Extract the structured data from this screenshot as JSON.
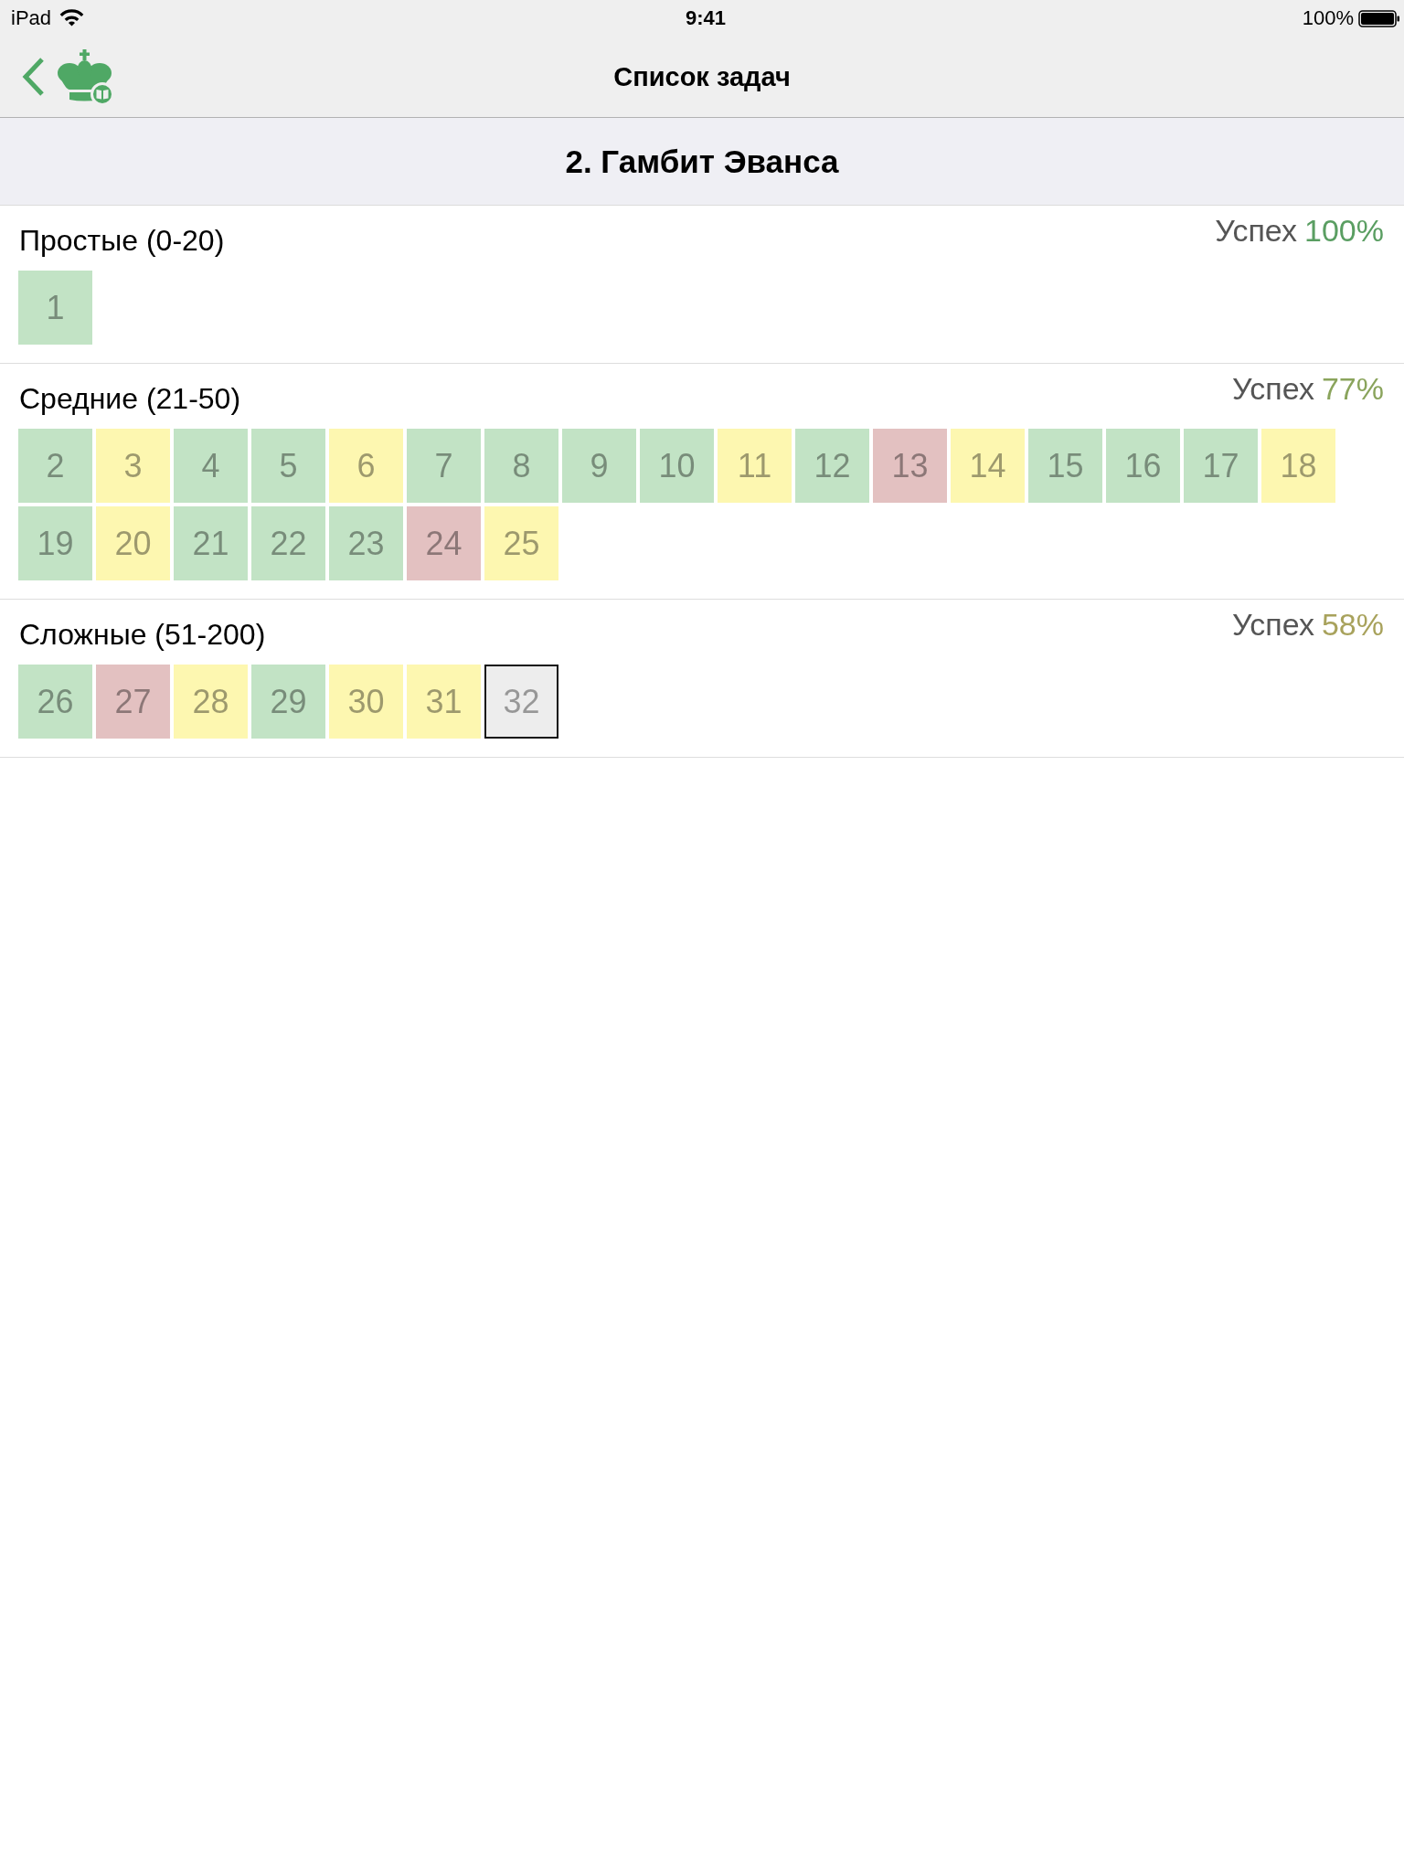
{
  "status_bar": {
    "device": "iPad",
    "time": "9:41",
    "battery": "100%"
  },
  "nav_bar": {
    "title": "Список задач"
  },
  "header": {
    "title": "2. Гамбит Эванса"
  },
  "sections": [
    {
      "title": "Простые (0-20)",
      "success": {
        "label": "Успех",
        "value": "100%",
        "color": "#5a9e62"
      },
      "tasks": [
        {
          "number": "1",
          "color": "#c2e3c5",
          "selected": false
        }
      ]
    },
    {
      "title": "Средние (21-50)",
      "success": {
        "label": "Успех",
        "value": "77%",
        "color": "#8aa45c"
      },
      "tasks": [
        {
          "number": "2",
          "color": "#c2e3c5",
          "selected": false
        },
        {
          "number": "3",
          "color": "#fdf7b0",
          "selected": false
        },
        {
          "number": "4",
          "color": "#c2e3c5",
          "selected": false
        },
        {
          "number": "5",
          "color": "#c2e3c5",
          "selected": false
        },
        {
          "number": "6",
          "color": "#fdf7b0",
          "selected": false
        },
        {
          "number": "7",
          "color": "#c2e3c5",
          "selected": false
        },
        {
          "number": "8",
          "color": "#c2e3c5",
          "selected": false
        },
        {
          "number": "9",
          "color": "#c2e3c5",
          "selected": false
        },
        {
          "number": "10",
          "color": "#c2e3c5",
          "selected": false
        },
        {
          "number": "11",
          "color": "#fdf7b0",
          "selected": false
        },
        {
          "number": "12",
          "color": "#c2e3c5",
          "selected": false
        },
        {
          "number": "13",
          "color": "#e3c1c1",
          "selected": false
        },
        {
          "number": "14",
          "color": "#fdf7b0",
          "selected": false
        },
        {
          "number": "15",
          "color": "#c2e3c5",
          "selected": false
        },
        {
          "number": "16",
          "color": "#c2e3c5",
          "selected": false
        },
        {
          "number": "17",
          "color": "#c2e3c5",
          "selected": false
        },
        {
          "number": "18",
          "color": "#fdf7b0",
          "selected": false
        },
        {
          "number": "19",
          "color": "#c2e3c5",
          "selected": false
        },
        {
          "number": "20",
          "color": "#fdf7b0",
          "selected": false
        },
        {
          "number": "21",
          "color": "#c2e3c5",
          "selected": false
        },
        {
          "number": "22",
          "color": "#c2e3c5",
          "selected": false
        },
        {
          "number": "23",
          "color": "#c2e3c5",
          "selected": false
        },
        {
          "number": "24",
          "color": "#e3c1c1",
          "selected": false
        },
        {
          "number": "25",
          "color": "#fdf7b0",
          "selected": false
        }
      ]
    },
    {
      "title": "Сложные (51-200)",
      "success": {
        "label": "Успех",
        "value": "58%",
        "color": "#a8a25c"
      },
      "tasks": [
        {
          "number": "26",
          "color": "#c2e3c5",
          "selected": false
        },
        {
          "number": "27",
          "color": "#e3c1c1",
          "selected": false
        },
        {
          "number": "28",
          "color": "#fdf7b0",
          "selected": false
        },
        {
          "number": "29",
          "color": "#c2e3c5",
          "selected": false
        },
        {
          "number": "30",
          "color": "#fdf7b0",
          "selected": false
        },
        {
          "number": "31",
          "color": "#fdf7b0",
          "selected": false
        },
        {
          "number": "32",
          "color": "#ededed",
          "selected": true
        }
      ]
    }
  ]
}
